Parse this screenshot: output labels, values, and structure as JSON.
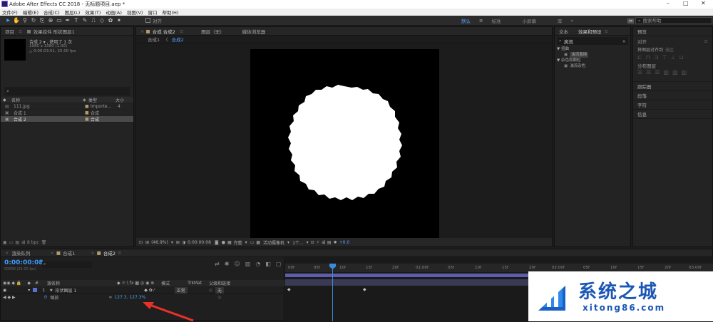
{
  "window": {
    "title": "Adobe After Effects CC 2018 - 无标题项目.aep *",
    "min": "–",
    "max": "□",
    "close": "✕"
  },
  "menu": [
    "文件(F)",
    "编辑(E)",
    "合成(C)",
    "图层(L)",
    "效果(T)",
    "动画(A)",
    "视图(V)",
    "窗口",
    "帮助(H)"
  ],
  "toolbar": {
    "align_label": "对齐",
    "workspaces": [
      "默认",
      "标准",
      "小屏幕",
      "库"
    ],
    "search_placeholder": "搜索帮助"
  },
  "project": {
    "tab_project": "项目",
    "tab_effects_controls": "效果控件 形状图层1",
    "comp_name": "合成 2 ▾ , 使用了 1 次",
    "comp_size": "1080 x 1080 (1.00)",
    "comp_duration": "△ 0:00:03:01, 25.00 fps",
    "search_icon": "⌕",
    "col_name": "名称",
    "col_type": "类型",
    "col_size": "大小",
    "items": [
      {
        "name": "111.jpg",
        "type": "Importe...",
        "size": "4"
      },
      {
        "name": "合成 1",
        "type": "合成",
        "size": ""
      },
      {
        "name": "合成 2",
        "type": "合成",
        "size": ""
      }
    ],
    "bpc": "8 bpc"
  },
  "viewer": {
    "tab_comp": "合成 合成2",
    "tab_layer": "图层（无）",
    "tab_footage": "媒体浏览器",
    "breadcrumb_1": "合成1",
    "breadcrumb_sep": "〈",
    "breadcrumb_2": "合成2",
    "zoom": "(46.9%)",
    "timecode": "0:00:00:08",
    "quality": "完整",
    "camera": "活动摄像机",
    "views": "1个...",
    "exposure": "+0.0"
  },
  "effects": {
    "tab_text": "文本",
    "tab_effects": "效果和预设",
    "search_value": "滴流",
    "group1": "▼ 扭曲",
    "item1": "湍流置换",
    "group2": "▼ 杂色和颗粒",
    "item2": "湍流杂色"
  },
  "right_panels": {
    "preview": "预览",
    "align": "对齐",
    "align_to_label": "将图层对齐到",
    "align_to_value": "选区",
    "distribute": "分布图层",
    "tracker": "跟踪器",
    "paragraph": "段落",
    "character": "字符",
    "info": "信息"
  },
  "timeline": {
    "tab_render": "渲染队列",
    "tab_comp1": "合成1",
    "tab_comp2": "合成2",
    "timecode": "0:00:00:08",
    "frame_info": "00008 (25.00 fps)",
    "col_layer_name": "源名称",
    "col_mode": "模式",
    "col_trkmat": "TrkMat",
    "col_parent": "父级和链接",
    "layer_number": "1",
    "layer_name": "形状图层 1",
    "layer_mode": "正常",
    "layer_parent": "无",
    "prop_name": "缩放",
    "prop_value": "127.3, 127.3%",
    "ruler": [
      "00f",
      "05f",
      "10f",
      "15f",
      "20f",
      "01:00f",
      "05f",
      "10f",
      "15f",
      "20f",
      "02:00f",
      "05f",
      "10f",
      "15f",
      "20f",
      "03:00f"
    ]
  },
  "watermark": {
    "brand": "系统之城",
    "url": "xitong86.com"
  },
  "colors": {
    "accent": "#2d8ceb",
    "playhead": "#3b8bd9",
    "workarea": "#5d5dab",
    "arrow": "#e8302a"
  }
}
